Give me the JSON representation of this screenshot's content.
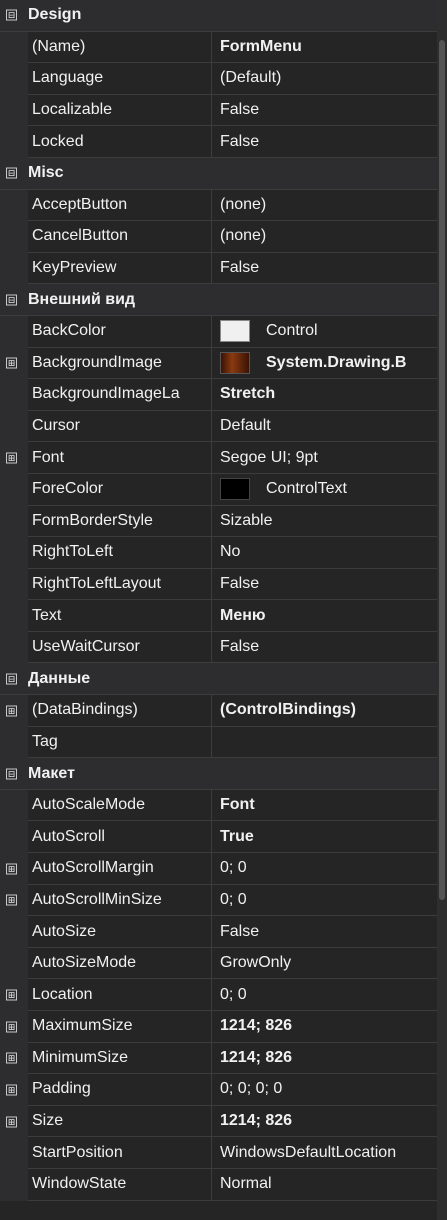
{
  "categories": [
    {
      "name": "Design",
      "expanded": true,
      "props": [
        {
          "label": "(Name)",
          "value": "FormMenu",
          "bold": true
        },
        {
          "label": "Language",
          "value": "(Default)"
        },
        {
          "label": "Localizable",
          "value": "False"
        },
        {
          "label": "Locked",
          "value": "False"
        }
      ]
    },
    {
      "name": "Misc",
      "expanded": true,
      "props": [
        {
          "label": "AcceptButton",
          "value": "(none)"
        },
        {
          "label": "CancelButton",
          "value": "(none)"
        },
        {
          "label": "KeyPreview",
          "value": "False"
        }
      ]
    },
    {
      "name": "Внешний вид",
      "expanded": true,
      "props": [
        {
          "label": "BackColor",
          "value": "Control",
          "swatch": "white"
        },
        {
          "label": "BackgroundImage",
          "value": "System.Drawing.B",
          "bold": true,
          "swatch": "image",
          "expandable": true
        },
        {
          "label": "BackgroundImageLa",
          "value": "Stretch",
          "bold": true
        },
        {
          "label": "Cursor",
          "value": "Default"
        },
        {
          "label": "Font",
          "value": "Segoe UI; 9pt",
          "expandable": true
        },
        {
          "label": "ForeColor",
          "value": "ControlText",
          "swatch": "black"
        },
        {
          "label": "FormBorderStyle",
          "value": "Sizable"
        },
        {
          "label": "RightToLeft",
          "value": "No"
        },
        {
          "label": "RightToLeftLayout",
          "value": "False"
        },
        {
          "label": "Text",
          "value": "Меню",
          "bold": true
        },
        {
          "label": "UseWaitCursor",
          "value": "False"
        }
      ]
    },
    {
      "name": "Данные",
      "expanded": true,
      "props": [
        {
          "label": "(DataBindings)",
          "value": "(ControlBindings)",
          "bold": true,
          "expandable": true
        },
        {
          "label": "Tag",
          "value": ""
        }
      ]
    },
    {
      "name": "Макет",
      "expanded": true,
      "props": [
        {
          "label": "AutoScaleMode",
          "value": "Font",
          "bold": true
        },
        {
          "label": "AutoScroll",
          "value": "True",
          "bold": true
        },
        {
          "label": "AutoScrollMargin",
          "value": "0; 0",
          "expandable": true
        },
        {
          "label": "AutoScrollMinSize",
          "value": "0; 0",
          "expandable": true
        },
        {
          "label": "AutoSize",
          "value": "False"
        },
        {
          "label": "AutoSizeMode",
          "value": "GrowOnly"
        },
        {
          "label": "Location",
          "value": "0; 0",
          "expandable": true
        },
        {
          "label": "MaximumSize",
          "value": "1214; 826",
          "bold": true,
          "expandable": true
        },
        {
          "label": "MinimumSize",
          "value": "1214; 826",
          "bold": true,
          "expandable": true
        },
        {
          "label": "Padding",
          "value": "0; 0; 0; 0",
          "expandable": true
        },
        {
          "label": "Size",
          "value": "1214; 826",
          "bold": true,
          "expandable": true
        },
        {
          "label": "StartPosition",
          "value": "WindowsDefaultLocation"
        },
        {
          "label": "WindowState",
          "value": "Normal"
        }
      ]
    }
  ],
  "glyphs": {
    "expanded": "⊟",
    "collapsed": "⊞"
  },
  "colors": {
    "background": "#252526",
    "gutter": "#2d2d30",
    "grid_line": "#3c3c3c",
    "text": "#f1f1f1"
  }
}
